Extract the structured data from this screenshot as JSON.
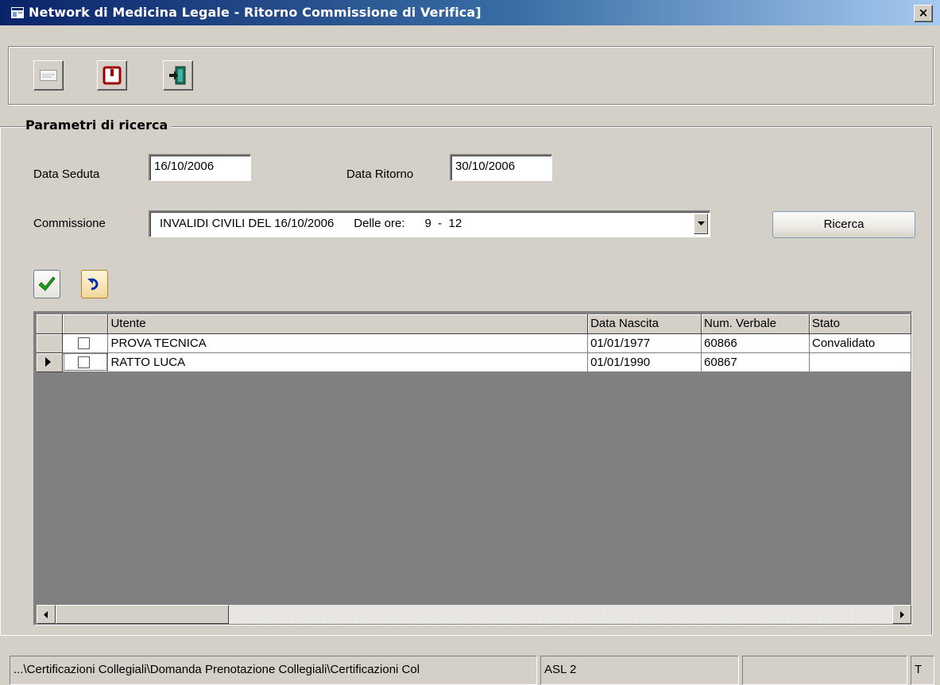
{
  "window": {
    "title": "Network di Medicina Legale - Ritorno Commissione di Verifica]",
    "close_label": "×"
  },
  "toolbar": {
    "buttons": [
      {
        "icon": "envelope-icon"
      },
      {
        "icon": "power-icon"
      },
      {
        "icon": "exit-door-icon"
      }
    ]
  },
  "search": {
    "group_title": "Parametri di ricerca",
    "data_seduta_label": "Data Seduta",
    "data_seduta_value": "16/10/2006",
    "data_ritorno_label": "Data Ritorno",
    "data_ritorno_value": "30/10/2006",
    "commissione_label": "Commissione",
    "commissione_value": "INVALIDI CIVILI DEL 16/10/2006      Delle ore:      9  -  12",
    "ricerca_label": "Ricerca"
  },
  "actions": {
    "confirm_icon": "checkmark-icon",
    "undo_icon": "undo-icon"
  },
  "grid": {
    "columns": [
      "Utente",
      "Data Nascita",
      "Num. Verbale",
      "Stato"
    ],
    "rows": [
      {
        "utente": "PROVA TECNICA",
        "data_nascita": "01/01/1977",
        "num_verbale": "60866",
        "stato": "Convalidato",
        "checked": false,
        "current": false
      },
      {
        "utente": "RATTO LUCA",
        "data_nascita": "01/01/1990",
        "num_verbale": "60867",
        "stato": "",
        "checked": false,
        "current": true
      }
    ]
  },
  "statusbar": {
    "path": "...\\Certificazioni Collegiali\\Domanda Prenotazione Collegiali\\Certificazioni Col",
    "asl": "ASL 2",
    "empty": "",
    "mode": "T"
  },
  "colors": {
    "titlebar_start": "#0a246a",
    "titlebar_end": "#a6caf0",
    "face": "#d4d0c8"
  }
}
